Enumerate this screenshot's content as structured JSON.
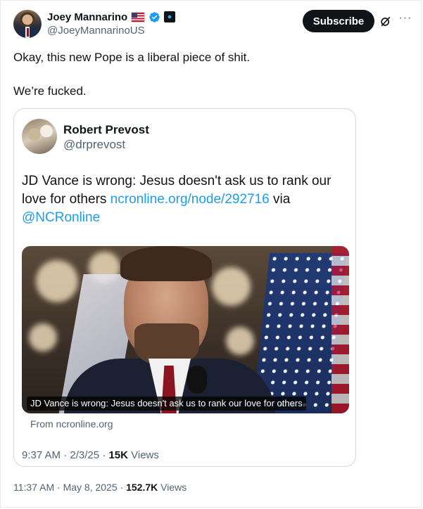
{
  "author": {
    "display_name": "Joey Mannarino",
    "handle": "@JoeyMannarinoUS",
    "badges": [
      "us-flag-icon",
      "verified-badge-icon",
      "affiliate-badge-icon"
    ]
  },
  "actions": {
    "subscribe_label": "Subscribe",
    "grok_icon": "grok-icon",
    "more_icon": "more-icon",
    "more_label": "···"
  },
  "tweet": {
    "line1": "Okay, this new Pope is a liberal piece of shit.",
    "line2": "We’re fucked."
  },
  "quoted": {
    "display_name": "Robert Prevost",
    "handle": "@drprevost",
    "text_before": "JD Vance is wrong: Jesus doesn't ask us to rank our love for others ",
    "link": "ncronline.org/node/292716",
    "text_mid": " via ",
    "mention": "@NCRonline",
    "card_caption": "JD Vance is wrong: Jesus doesn't ask us to rank our love for others",
    "card_source": "From ncronline.org",
    "time": "9:37 AM",
    "sep1": " · ",
    "date": "2/3/25",
    "sep2": " · ",
    "views_count": "15K",
    "views_label": " Views"
  },
  "meta": {
    "time": "11:37 AM",
    "sep1": " · ",
    "date": "May 8, 2025",
    "sep2": " · ",
    "views_count": "152.7K",
    "views_label": " Views"
  },
  "colors": {
    "text": "#0f1419",
    "secondary": "#536471",
    "link": "#1d9bf0",
    "verified": "#1d9bf0"
  }
}
